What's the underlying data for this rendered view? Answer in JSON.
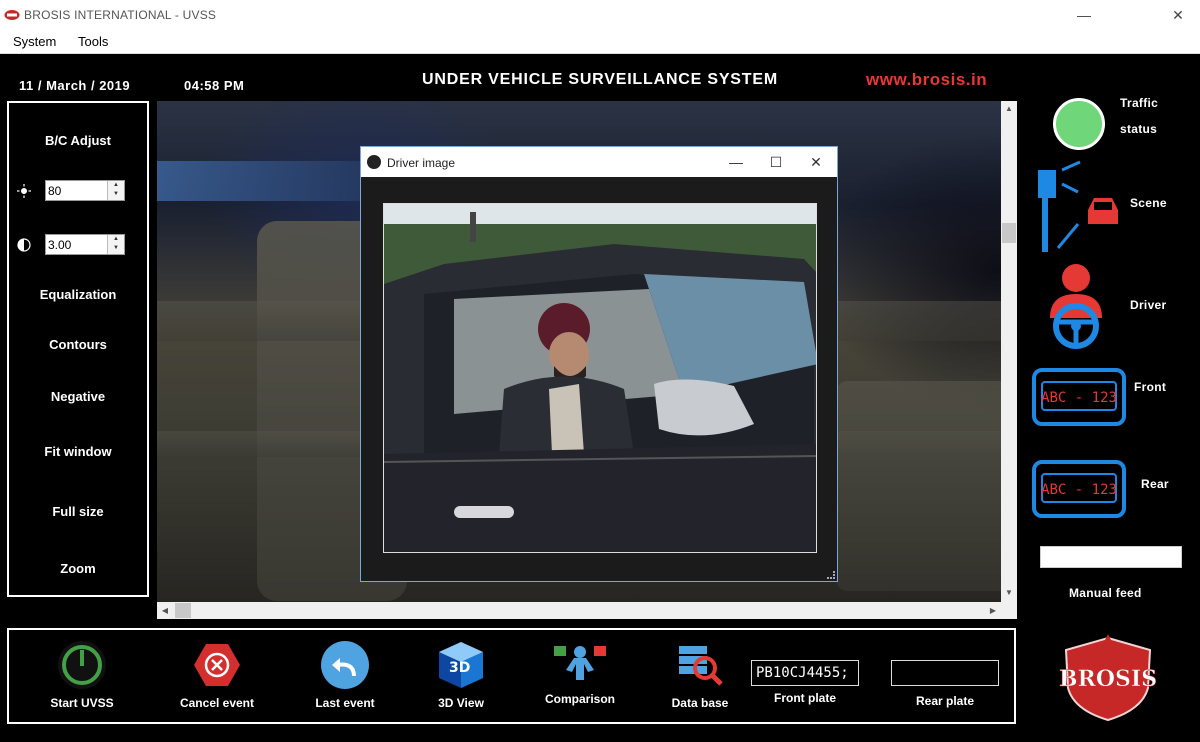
{
  "window": {
    "title": "BROSIS INTERNATIONAL - UVSS",
    "minimize": "—",
    "close": "✕"
  },
  "menu": {
    "items": [
      "System",
      "Tools"
    ]
  },
  "header": {
    "date": "11 / March / 2019",
    "time": "04:58 PM",
    "title": "UNDER VEHICLE SURVEILLANCE SYSTEM",
    "website": "www.brosis.in"
  },
  "left_panel": {
    "bc_adjust": "B/C Adjust",
    "brightness_value": "80",
    "contrast_value": "3.00",
    "brightness_icon": "sun-icon",
    "contrast_icon": "contrast-icon",
    "equalization": "Equalization",
    "contours": "Contours",
    "negative": "Negative",
    "fit_window": "Fit window",
    "full_size": "Full size",
    "zoom": "Zoom"
  },
  "dialog": {
    "title": "Driver image",
    "minimize": "—",
    "maximize": "☐",
    "close": "✕"
  },
  "right_panel": {
    "traffic_status_line1": "Traffic",
    "traffic_status_line2": "status",
    "traffic_color": "#6fd67a",
    "scene": "Scene",
    "driver": "Driver",
    "front": "Front",
    "rear": "Rear",
    "plate_icon_text": "ABC - 123",
    "manual_feed": "Manual feed",
    "accent_blue": "#1e88e5",
    "accent_red": "#e53935"
  },
  "bottom_panel": {
    "start_uvss": "Start UVSS",
    "cancel_event": "Cancel event",
    "last_event": "Last event",
    "view_3d": "3D View",
    "comparison": "Comparison",
    "data_base": "Data base",
    "front_plate_value": "PB10CJ4455;",
    "front_plate_label": "Front plate",
    "rear_plate_value": "",
    "rear_plate_label": "Rear plate"
  },
  "logo": {
    "text": "BROSIS"
  }
}
